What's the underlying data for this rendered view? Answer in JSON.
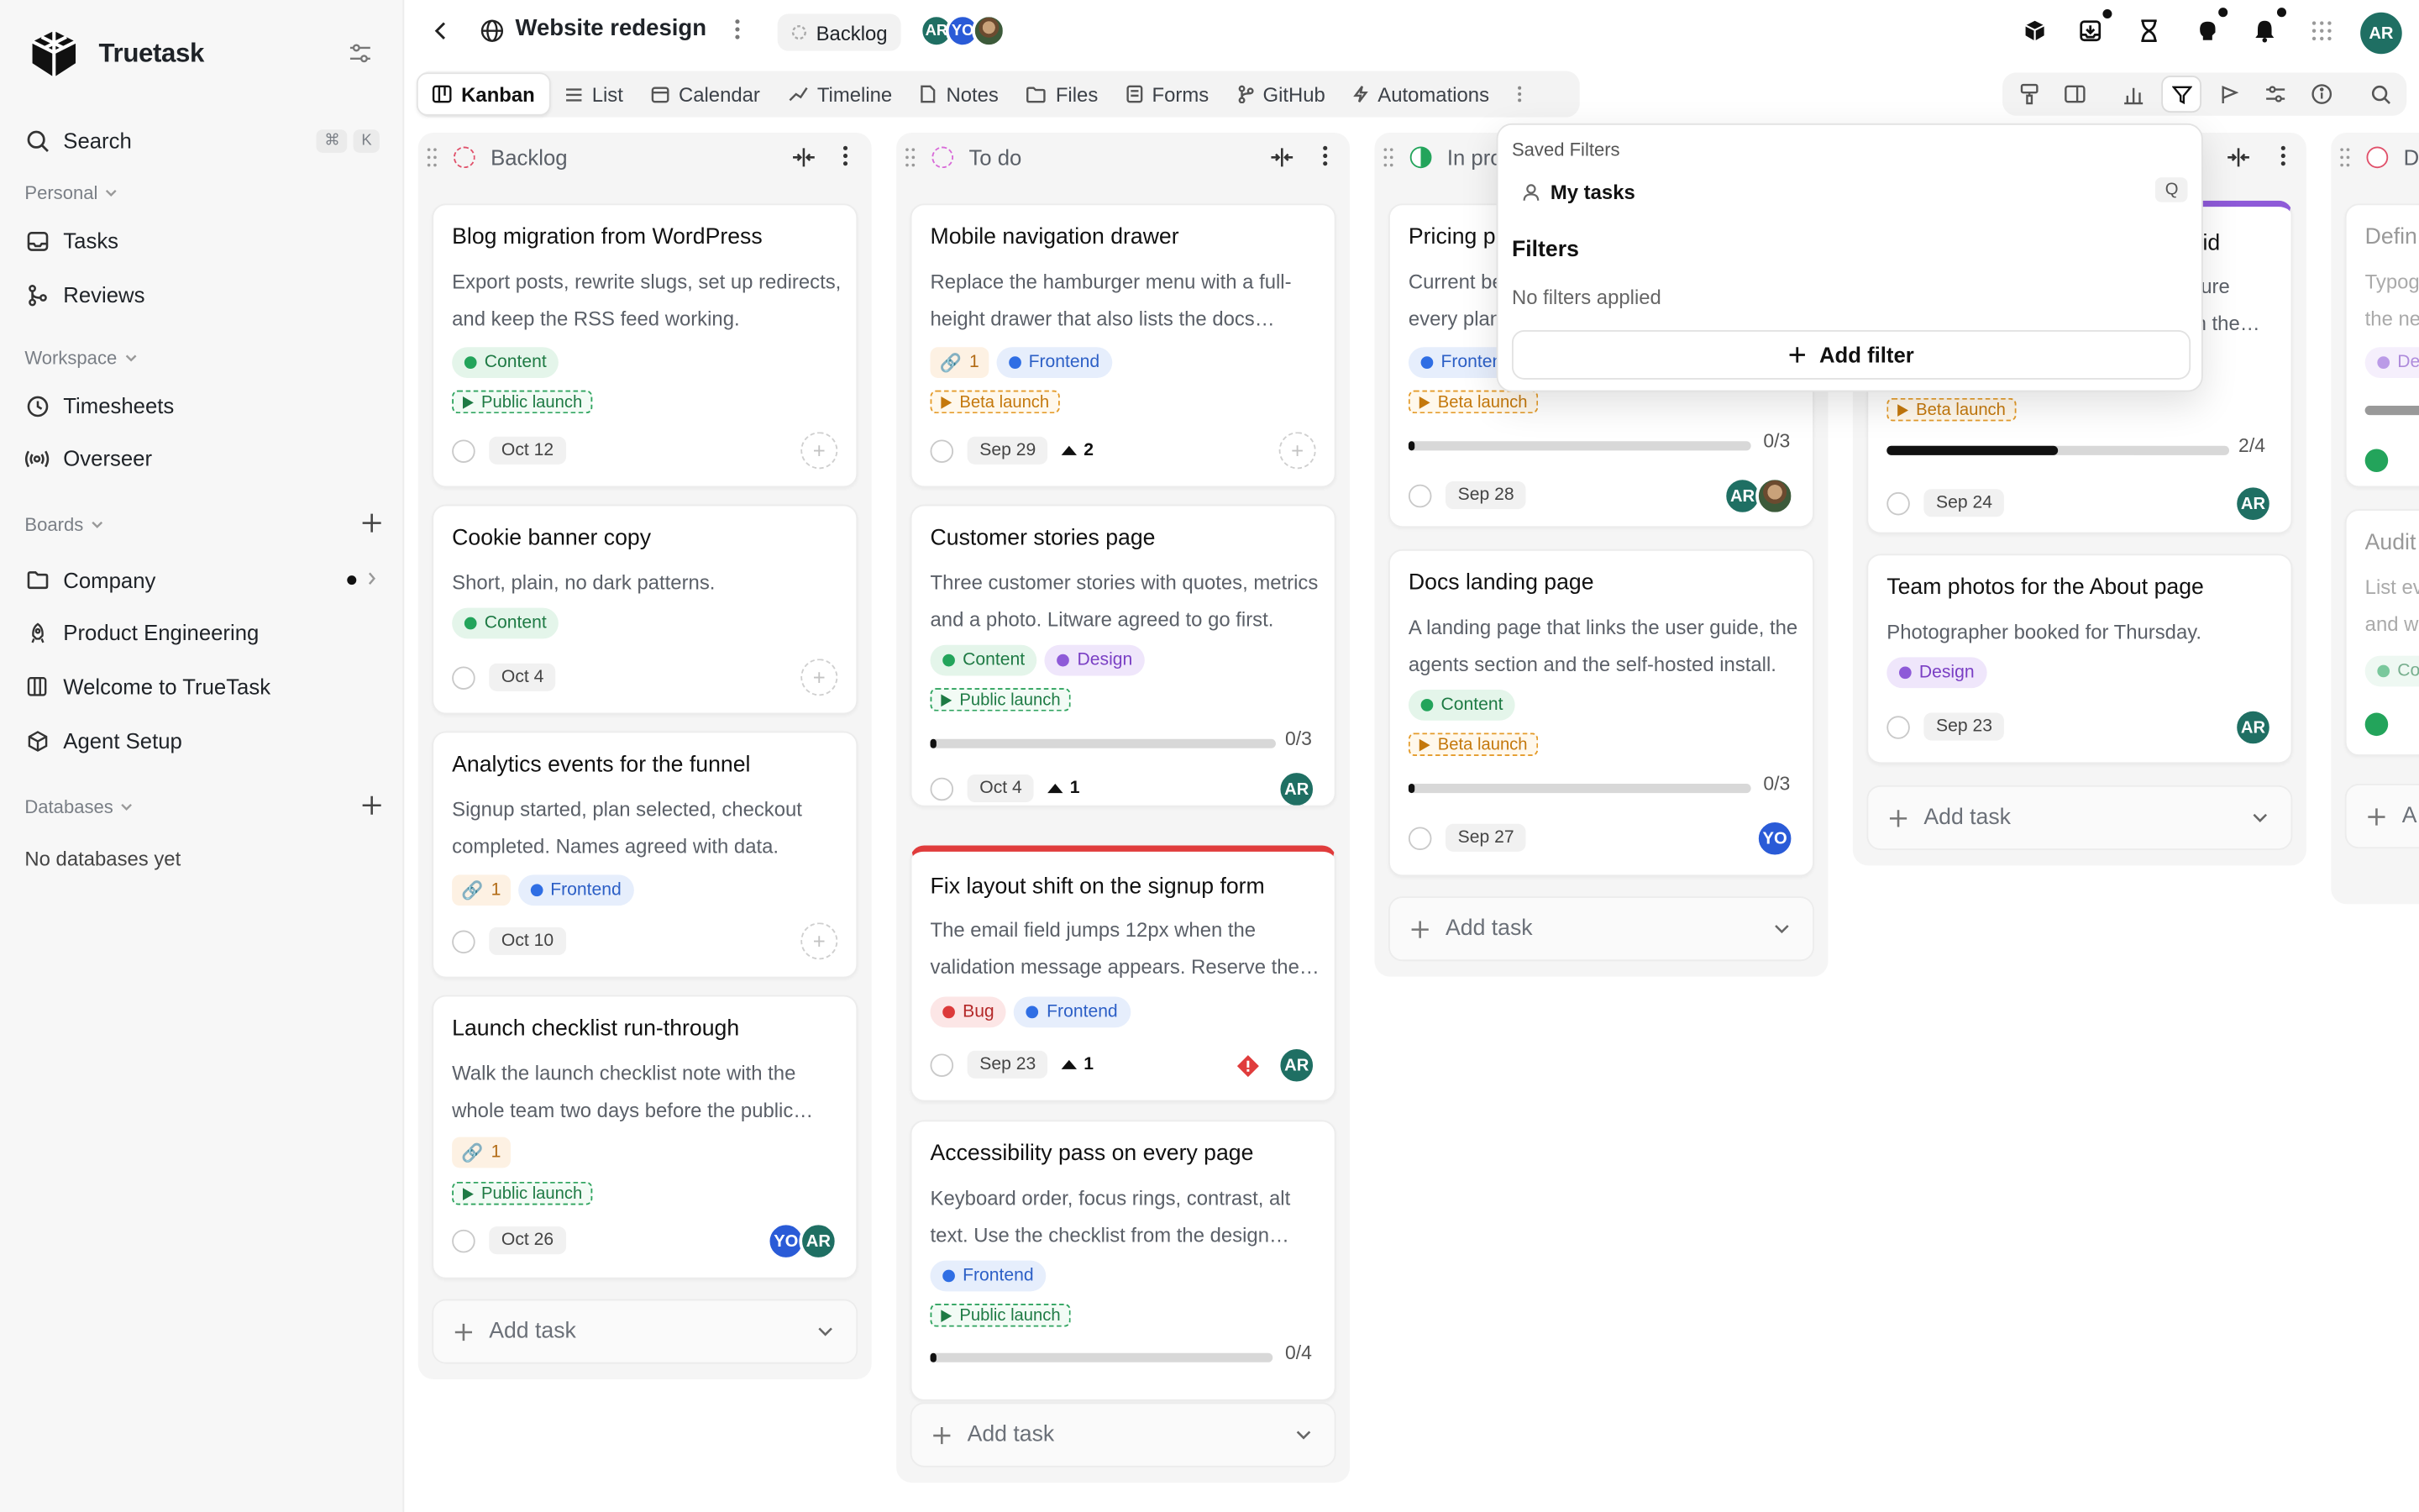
{
  "app": {
    "name": "Truetask"
  },
  "sidebar": {
    "search_label": "Search",
    "search_shortcut": [
      "⌘",
      "K"
    ],
    "personal_label": "Personal",
    "personal_items": [
      {
        "label": "Tasks",
        "icon": "inbox-icon"
      },
      {
        "label": "Reviews",
        "icon": "git-merge-icon"
      }
    ],
    "workspace_label": "Workspace",
    "workspace_items": [
      {
        "label": "Timesheets",
        "icon": "clock-icon"
      },
      {
        "label": "Overseer",
        "icon": "broadcast-icon"
      }
    ],
    "boards_label": "Boards",
    "boards": [
      {
        "label": "Company",
        "icon": "folder-icon"
      },
      {
        "label": "Product Engineering",
        "icon": "rocket-icon"
      },
      {
        "label": "Welcome to TrueTask",
        "icon": "board-icon"
      },
      {
        "label": "Agent Setup",
        "icon": "cube-icon"
      }
    ],
    "databases_label": "Databases",
    "databases_empty": "No databases yet"
  },
  "topbar": {
    "title": "Website redesign",
    "status": "Backlog",
    "member_initials": [
      "AR",
      "YO"
    ],
    "user_initials": "AR"
  },
  "tabs": [
    "Kanban",
    "List",
    "Calendar",
    "Timeline",
    "Notes",
    "Files",
    "Forms",
    "GitHub",
    "Automations"
  ],
  "columns": [
    {
      "title": "Backlog",
      "status_color": "#e0506a",
      "add_task": "Add task",
      "cards": [
        {
          "title": "Blog migration from WordPress",
          "desc": "Export posts, rewrite slugs, set up redirects, and keep the RSS feed working.",
          "tags": [
            "Content"
          ],
          "milestone": "Public launch",
          "date": "Oct 12"
        },
        {
          "title": "Cookie banner copy",
          "desc": "Short, plain, no dark patterns.",
          "tags": [
            "Content"
          ],
          "date": "Oct 4"
        },
        {
          "title": "Analytics events for the funnel",
          "desc": "Signup started, plan selected, checkout completed. Names agreed with data.",
          "link_count": "1",
          "tags": [
            "Frontend"
          ],
          "date": "Oct 10"
        },
        {
          "title": "Launch checklist run-through",
          "desc": "Walk the launch checklist note with the whole team two days before the public…",
          "link_count": "1",
          "milestone": "Public launch",
          "date": "Oct 26",
          "assignees": [
            "YO",
            "AR"
          ]
        }
      ]
    },
    {
      "title": "To do",
      "status_color": "#d86ad8",
      "add_task": "Add task",
      "cards": [
        {
          "title": "Mobile navigation drawer",
          "desc": "Replace the hamburger menu with a full-height drawer that also lists the docs…",
          "link_count": "1",
          "tags": [
            "Frontend"
          ],
          "milestone": "Beta launch",
          "date": "Sep 29",
          "priority": "2"
        },
        {
          "title": "Customer stories page",
          "desc": "Three customer stories with quotes, metrics and a photo. Litware agreed to go first.",
          "tags": [
            "Content",
            "Design"
          ],
          "milestone": "Public launch",
          "progress": 0,
          "progress_text": "0/3",
          "date": "Oct 4",
          "priority": "1",
          "assignees": [
            "AR"
          ]
        },
        {
          "title": "Fix layout shift on the signup form",
          "desc": "The email field jumps 12px when the validation message appears. Reserve the…",
          "tags": [
            "Bug",
            "Frontend"
          ],
          "date": "Sep 23",
          "priority": "1",
          "urgent": true,
          "assignees": [
            "AR"
          ]
        },
        {
          "title": "Accessibility pass on every page",
          "desc": "Keyboard order, focus rings, contrast, alt text. Use the checklist from the design…",
          "tags": [
            "Frontend"
          ],
          "milestone": "Public launch",
          "progress": 0,
          "progress_text": "0/4"
        }
      ]
    },
    {
      "title": "In pro",
      "status_color": "#23a45b",
      "add_task": "Add task",
      "cards": [
        {
          "title": "Pricing p",
          "desc": "Current be",
          "desc2": "every plan",
          "tags": [
            "Frontend"
          ],
          "milestone": "Beta launch",
          "progress": 0,
          "progress_text": "0/3",
          "date": "Sep 28",
          "assignees": [
            "AR"
          ]
        },
        {
          "title": "Docs landing page",
          "desc": "A landing page that links the user guide, the agents section and the self-hosted install.",
          "tags": [
            "Content"
          ],
          "milestone": "Beta launch",
          "progress": 0,
          "progress_text": "0/3",
          "date": "Sep 27",
          "assignees": [
            "YO"
          ]
        }
      ]
    },
    {
      "title": "",
      "add_task": "Add task",
      "cards": [
        {
          "title": "rid",
          "desc": "ture",
          "desc2": "n the…",
          "milestone": "Beta launch",
          "progress": 0.5,
          "progress_text": "2/4",
          "date": "Sep 24",
          "assignees": [
            "AR"
          ]
        },
        {
          "title": "Team photos for the About page",
          "desc": "Photographer booked for Thursday.",
          "tags": [
            "Design"
          ],
          "date": "Sep 23",
          "assignees": [
            "AR"
          ]
        }
      ]
    },
    {
      "title": "D",
      "status_color": "#e0506a",
      "cards": [
        {
          "title": "Defin",
          "desc": "Typog",
          "desc2": "the ne",
          "tags": [
            "Des"
          ]
        },
        {
          "title": "Audit",
          "desc": "List ev",
          "desc2": "and w",
          "tags": [
            "Con"
          ]
        }
      ],
      "add_task": "A"
    }
  ],
  "filter_popover": {
    "saved_label": "Saved Filters",
    "saved_item": "My tasks",
    "saved_key": "Q",
    "filters_heading": "Filters",
    "empty_text": "No filters applied",
    "add_button": "Add filter"
  }
}
